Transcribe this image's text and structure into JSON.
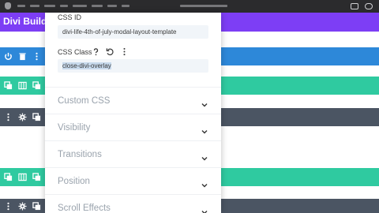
{
  "app": {
    "header_title": "Divi Builder"
  },
  "modal": {
    "css_id": {
      "label": "CSS ID",
      "value": "divi-life-4th-of-july-modal-layout-template"
    },
    "css_class": {
      "label": "CSS Class",
      "value": "close-divi-overlay",
      "selected": true
    },
    "toggles": [
      {
        "label": "Custom CSS"
      },
      {
        "label": "Visibility"
      },
      {
        "label": "Transitions"
      },
      {
        "label": "Position"
      },
      {
        "label": "Scroll Effects"
      }
    ],
    "label_icons": [
      "help-icon",
      "undo-icon",
      "more-options-icon"
    ]
  },
  "bars": [
    {
      "color": "#2d88d9",
      "icons": [
        "power-icon",
        "trash-icon",
        "more-icon"
      ]
    },
    {
      "color": "#2fcaa0",
      "icons": [
        "duplicate-icon",
        "columns-icon",
        "duplicate-icon",
        "power-icon"
      ]
    },
    {
      "color": "#4b5563",
      "icons": [
        "more-icon",
        "settings-icon",
        "duplicate-icon",
        "power-icon"
      ]
    },
    {
      "color": "#2fcaa0",
      "icons": [
        "duplicate-icon",
        "columns-icon",
        "duplicate-icon",
        "power-icon"
      ]
    },
    {
      "color": "#4b5563",
      "icons": [
        "more-icon",
        "settings-icon",
        "duplicate-icon",
        "power-icon"
      ]
    }
  ],
  "colors": {
    "header": "#7d3ef5",
    "section_blue": "#2d88d9",
    "row_teal": "#2fcaa0",
    "module_slate": "#4b5563",
    "selection": "#c7d9ec"
  }
}
